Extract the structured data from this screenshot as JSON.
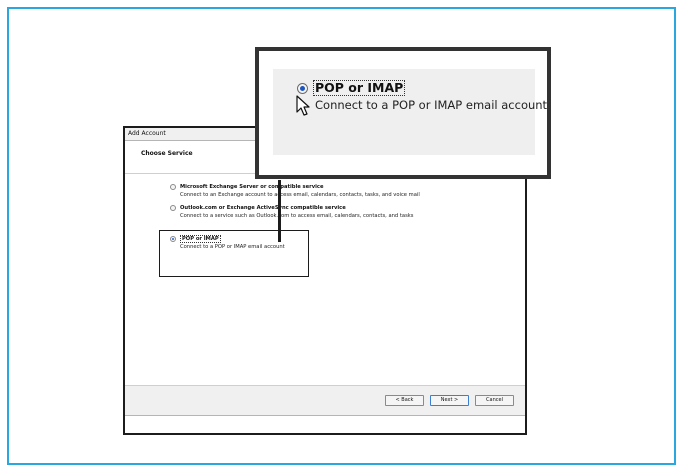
{
  "dialog": {
    "title": "Add Account",
    "heading": "Choose Service",
    "options": [
      {
        "label": "Microsoft Exchange Server or compatible service",
        "description": "Connect to an Exchange account to access email, calendars, contacts, tasks, and voice mail",
        "selected": false
      },
      {
        "label": "Outlook.com or Exchange ActiveSync compatible service",
        "description": "Connect to a service such as Outlook.com to access email, calendars, contacts, and tasks",
        "selected": false
      },
      {
        "label": "POP or IMAP",
        "description": "Connect to a POP or IMAP email account",
        "selected": true
      }
    ],
    "buttons": {
      "back": "< Back",
      "next": "Next >",
      "cancel": "Cancel"
    }
  },
  "callout": {
    "label": "POP or IMAP",
    "description": "Connect to a POP or IMAP email account"
  },
  "colors": {
    "frame_border": "#2aa7de",
    "radio_selected": "#1e56c0"
  },
  "icons": [
    "radio-button-icon",
    "mouse-pointer-icon"
  ]
}
